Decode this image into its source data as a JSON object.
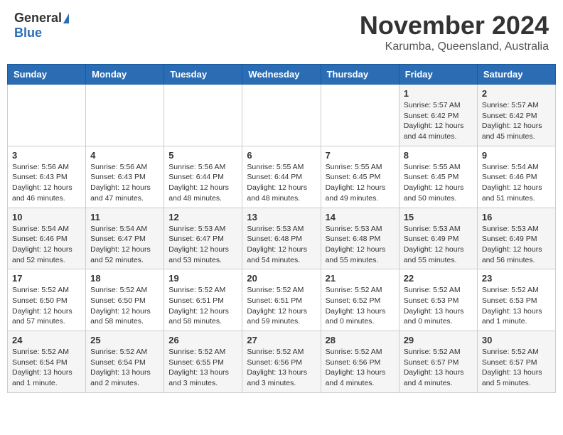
{
  "header": {
    "logo_general": "General",
    "logo_blue": "Blue",
    "month": "November 2024",
    "location": "Karumba, Queensland, Australia"
  },
  "days_of_week": [
    "Sunday",
    "Monday",
    "Tuesday",
    "Wednesday",
    "Thursday",
    "Friday",
    "Saturday"
  ],
  "weeks": [
    [
      {
        "day": "",
        "info": ""
      },
      {
        "day": "",
        "info": ""
      },
      {
        "day": "",
        "info": ""
      },
      {
        "day": "",
        "info": ""
      },
      {
        "day": "",
        "info": ""
      },
      {
        "day": "1",
        "info": "Sunrise: 5:57 AM\nSunset: 6:42 PM\nDaylight: 12 hours\nand 44 minutes."
      },
      {
        "day": "2",
        "info": "Sunrise: 5:57 AM\nSunset: 6:42 PM\nDaylight: 12 hours\nand 45 minutes."
      }
    ],
    [
      {
        "day": "3",
        "info": "Sunrise: 5:56 AM\nSunset: 6:43 PM\nDaylight: 12 hours\nand 46 minutes."
      },
      {
        "day": "4",
        "info": "Sunrise: 5:56 AM\nSunset: 6:43 PM\nDaylight: 12 hours\nand 47 minutes."
      },
      {
        "day": "5",
        "info": "Sunrise: 5:56 AM\nSunset: 6:44 PM\nDaylight: 12 hours\nand 48 minutes."
      },
      {
        "day": "6",
        "info": "Sunrise: 5:55 AM\nSunset: 6:44 PM\nDaylight: 12 hours\nand 48 minutes."
      },
      {
        "day": "7",
        "info": "Sunrise: 5:55 AM\nSunset: 6:45 PM\nDaylight: 12 hours\nand 49 minutes."
      },
      {
        "day": "8",
        "info": "Sunrise: 5:55 AM\nSunset: 6:45 PM\nDaylight: 12 hours\nand 50 minutes."
      },
      {
        "day": "9",
        "info": "Sunrise: 5:54 AM\nSunset: 6:46 PM\nDaylight: 12 hours\nand 51 minutes."
      }
    ],
    [
      {
        "day": "10",
        "info": "Sunrise: 5:54 AM\nSunset: 6:46 PM\nDaylight: 12 hours\nand 52 minutes."
      },
      {
        "day": "11",
        "info": "Sunrise: 5:54 AM\nSunset: 6:47 PM\nDaylight: 12 hours\nand 52 minutes."
      },
      {
        "day": "12",
        "info": "Sunrise: 5:53 AM\nSunset: 6:47 PM\nDaylight: 12 hours\nand 53 minutes."
      },
      {
        "day": "13",
        "info": "Sunrise: 5:53 AM\nSunset: 6:48 PM\nDaylight: 12 hours\nand 54 minutes."
      },
      {
        "day": "14",
        "info": "Sunrise: 5:53 AM\nSunset: 6:48 PM\nDaylight: 12 hours\nand 55 minutes."
      },
      {
        "day": "15",
        "info": "Sunrise: 5:53 AM\nSunset: 6:49 PM\nDaylight: 12 hours\nand 55 minutes."
      },
      {
        "day": "16",
        "info": "Sunrise: 5:53 AM\nSunset: 6:49 PM\nDaylight: 12 hours\nand 56 minutes."
      }
    ],
    [
      {
        "day": "17",
        "info": "Sunrise: 5:52 AM\nSunset: 6:50 PM\nDaylight: 12 hours\nand 57 minutes."
      },
      {
        "day": "18",
        "info": "Sunrise: 5:52 AM\nSunset: 6:50 PM\nDaylight: 12 hours\nand 58 minutes."
      },
      {
        "day": "19",
        "info": "Sunrise: 5:52 AM\nSunset: 6:51 PM\nDaylight: 12 hours\nand 58 minutes."
      },
      {
        "day": "20",
        "info": "Sunrise: 5:52 AM\nSunset: 6:51 PM\nDaylight: 12 hours\nand 59 minutes."
      },
      {
        "day": "21",
        "info": "Sunrise: 5:52 AM\nSunset: 6:52 PM\nDaylight: 13 hours\nand 0 minutes."
      },
      {
        "day": "22",
        "info": "Sunrise: 5:52 AM\nSunset: 6:53 PM\nDaylight: 13 hours\nand 0 minutes."
      },
      {
        "day": "23",
        "info": "Sunrise: 5:52 AM\nSunset: 6:53 PM\nDaylight: 13 hours\nand 1 minute."
      }
    ],
    [
      {
        "day": "24",
        "info": "Sunrise: 5:52 AM\nSunset: 6:54 PM\nDaylight: 13 hours\nand 1 minute."
      },
      {
        "day": "25",
        "info": "Sunrise: 5:52 AM\nSunset: 6:54 PM\nDaylight: 13 hours\nand 2 minutes."
      },
      {
        "day": "26",
        "info": "Sunrise: 5:52 AM\nSunset: 6:55 PM\nDaylight: 13 hours\nand 3 minutes."
      },
      {
        "day": "27",
        "info": "Sunrise: 5:52 AM\nSunset: 6:56 PM\nDaylight: 13 hours\nand 3 minutes."
      },
      {
        "day": "28",
        "info": "Sunrise: 5:52 AM\nSunset: 6:56 PM\nDaylight: 13 hours\nand 4 minutes."
      },
      {
        "day": "29",
        "info": "Sunrise: 5:52 AM\nSunset: 6:57 PM\nDaylight: 13 hours\nand 4 minutes."
      },
      {
        "day": "30",
        "info": "Sunrise: 5:52 AM\nSunset: 6:57 PM\nDaylight: 13 hours\nand 5 minutes."
      }
    ]
  ]
}
